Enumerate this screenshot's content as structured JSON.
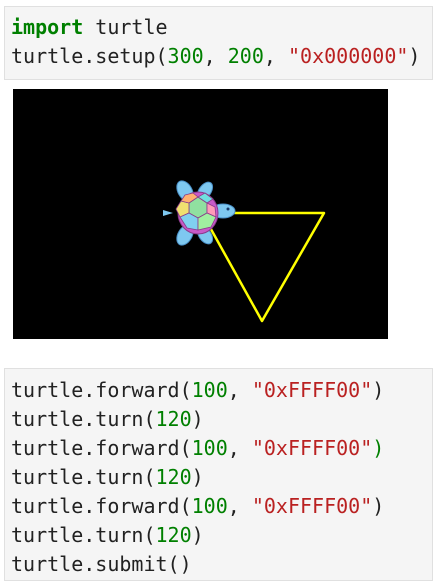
{
  "cell1": {
    "lines": [
      {
        "parts": [
          {
            "t": "import",
            "c": "kw"
          },
          {
            "t": " turtle",
            "c": "plain"
          }
        ]
      },
      {
        "parts": [
          {
            "t": "turtle.setup(",
            "c": "plain"
          },
          {
            "t": "300",
            "c": "num"
          },
          {
            "t": ", ",
            "c": "plain"
          },
          {
            "t": "200",
            "c": "num"
          },
          {
            "t": ", ",
            "c": "plain"
          },
          {
            "t": "\"0x000000\"",
            "c": "str"
          },
          {
            "t": ")",
            "c": "plain"
          }
        ]
      }
    ]
  },
  "canvas": {
    "background": "#000000",
    "line_color": "#FFFF00",
    "turtle_icon": "sea-turtle"
  },
  "cell2": {
    "lines": [
      {
        "parts": [
          {
            "t": "turtle.forward(",
            "c": "plain"
          },
          {
            "t": "100",
            "c": "num"
          },
          {
            "t": ", ",
            "c": "plain"
          },
          {
            "t": "\"0xFFFF00\"",
            "c": "str"
          },
          {
            "t": ")",
            "c": "plain"
          }
        ]
      },
      {
        "parts": [
          {
            "t": "turtle.turn(",
            "c": "plain"
          },
          {
            "t": "120",
            "c": "num"
          },
          {
            "t": ")",
            "c": "plain"
          }
        ]
      },
      {
        "parts": [
          {
            "t": "turtle.forward(",
            "c": "plain"
          },
          {
            "t": "100",
            "c": "num"
          },
          {
            "t": ", ",
            "c": "plain"
          },
          {
            "t": "\"0xFFFF00\"",
            "c": "str"
          },
          {
            "t": ")",
            "c": "num"
          }
        ]
      },
      {
        "parts": [
          {
            "t": "turtle.turn(",
            "c": "plain"
          },
          {
            "t": "120",
            "c": "num"
          },
          {
            "t": ")",
            "c": "plain"
          }
        ]
      },
      {
        "parts": [
          {
            "t": "turtle.forward(",
            "c": "plain"
          },
          {
            "t": "100",
            "c": "num"
          },
          {
            "t": ", ",
            "c": "plain"
          },
          {
            "t": "\"0xFFFF00\"",
            "c": "str"
          },
          {
            "t": ")",
            "c": "plain"
          }
        ]
      },
      {
        "parts": [
          {
            "t": "turtle.turn(",
            "c": "plain"
          },
          {
            "t": "120",
            "c": "num"
          },
          {
            "t": ")",
            "c": "plain"
          }
        ]
      },
      {
        "parts": [
          {
            "t": "turtle.submit()",
            "c": "plain"
          }
        ]
      }
    ]
  }
}
